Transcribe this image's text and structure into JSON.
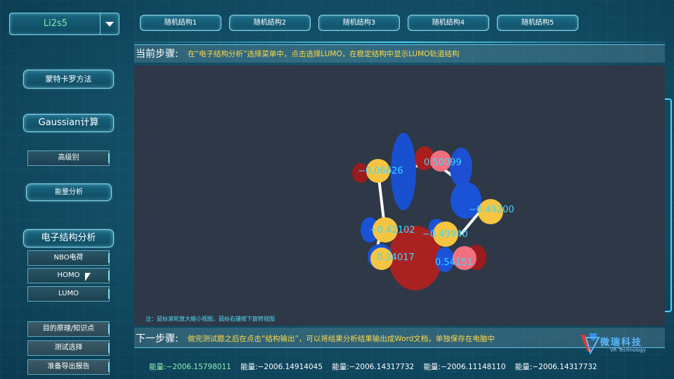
{
  "structure_select": {
    "value": "Li2s5"
  },
  "random_structures": [
    "随机结构1",
    "随机结构2",
    "随机结构3",
    "随机结构4",
    "随机结构5"
  ],
  "sidebar": {
    "monte_carlo": "蒙特卡罗方法",
    "gaussian": "Gaussian计算",
    "high_level": "高级别",
    "energy_analysis": "能量分析",
    "electronic_structure": "电子结构分析",
    "nbo": "NBO电荷",
    "homo": "HOMO",
    "lumo": "LUMO",
    "objective": "目的原理/知识点",
    "test": "测试选择",
    "export_report": "准备导出报告"
  },
  "current_step": {
    "label": "当前步骤:",
    "text": "在“电子结构分析”选择菜单中，点击选择LUMO，在稳定结构中显示LUMO轨道结构"
  },
  "viewer": {
    "note": "注：鼠标滚轮放大缩小视图，鼠标右键按下旋转视图",
    "atom_labels": [
      "−0.06626",
      "0.50099",
      "−0.49200",
      "−0.42102",
      "−0.49940",
      "0.34017",
      "0.54151"
    ]
  },
  "next_step": {
    "label": "下一步骤:",
    "text": "做完测试题之后在点击“结构输出”，可以将结果分析结果输出成Word文档，单独保存在电脑中"
  },
  "energies": [
    "能量:−2006.15798011",
    "能量:−2006.14914045",
    "能量:−2006.14317732",
    "能量:−2006.11148110",
    "能量:−2006.14317732"
  ],
  "logo": {
    "name": "微瑞科技",
    "tagline": "VR Technology"
  },
  "colors": {
    "accent": "#4fd2f5",
    "step_text": "#ffd84a",
    "active_energy": "#8ff0b4"
  }
}
